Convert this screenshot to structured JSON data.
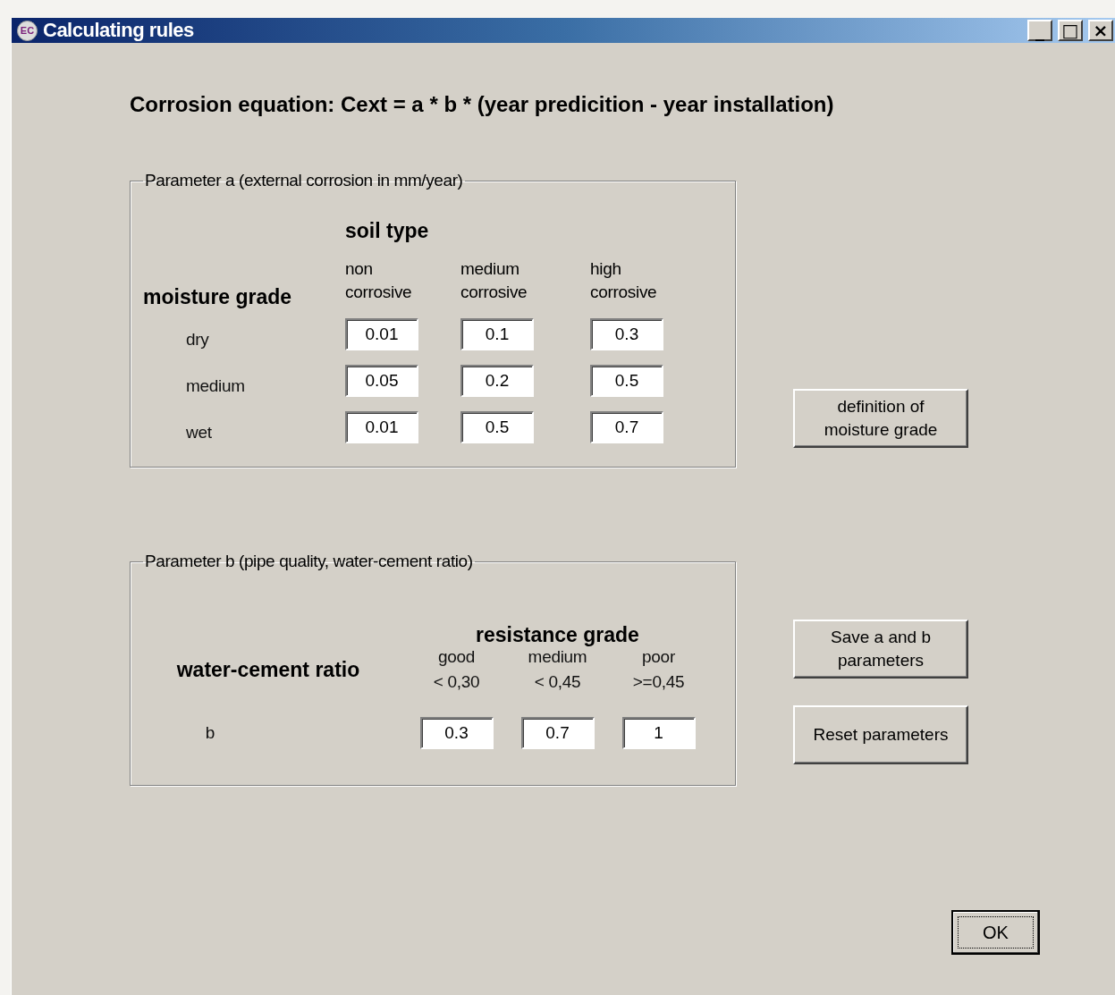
{
  "window": {
    "icon_text": "EC",
    "title": "Calculating rules",
    "controls": [
      "_",
      "□",
      "×"
    ]
  },
  "equation": "Corrosion equation: Cext = a * b * (year predicition - year installation)",
  "parameter_a": {
    "legend": "Parameter a (external corrosion in mm/year)",
    "column_group": "soil type",
    "row_group": "moisture grade",
    "columns": [
      "non corrosive",
      "medium corrosive",
      "high corrosive"
    ],
    "rows": [
      {
        "label": "dry",
        "values": [
          "0.01",
          "0.1",
          "0.3"
        ]
      },
      {
        "label": "medium",
        "values": [
          "0.05",
          "0.2",
          "0.5"
        ]
      },
      {
        "label": "wet",
        "values": [
          "0.01",
          "0.5",
          "0.7"
        ]
      }
    ]
  },
  "parameter_b": {
    "legend": "Parameter b (pipe quality, water-cement ratio)",
    "column_group": "resistance grade",
    "row_group": "water-cement ratio",
    "columns": [
      {
        "name": "good",
        "range": "< 0,30"
      },
      {
        "name": "medium",
        "range": "< 0,45"
      },
      {
        "name": "poor",
        "range": ">=0,45"
      }
    ],
    "row": {
      "label": "b",
      "values": [
        "0.3",
        "0.7",
        "1"
      ]
    }
  },
  "buttons": [
    "definition of\nmoisture grade",
    "Save a and b\nparameters",
    "Reset parameters"
  ],
  "ok_button": {
    "label": "OK",
    "focused": true
  }
}
